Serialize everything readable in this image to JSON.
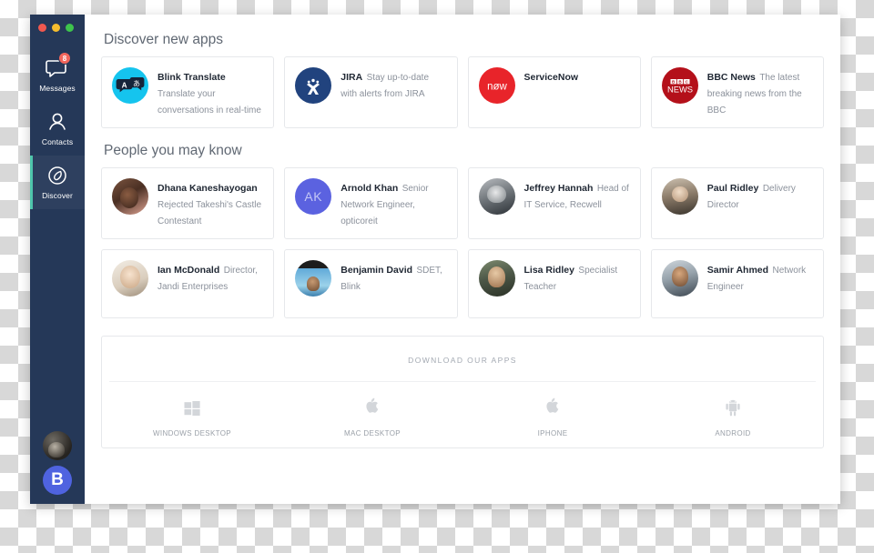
{
  "window": {
    "traffic_lights": [
      "close",
      "minimize",
      "maximize"
    ],
    "colors": {
      "sidebar_bg": "#253858",
      "active_indicator": "#4ec5ab",
      "badge": "#f2665c",
      "team_logo_bg": "#4f63e0"
    }
  },
  "sidebar": {
    "items": [
      {
        "label": "Messages",
        "icon": "message-bubble-icon",
        "badge": "8",
        "active": false
      },
      {
        "label": "Contacts",
        "icon": "person-outline-icon",
        "badge": "",
        "active": false
      },
      {
        "label": "Discover",
        "icon": "compass-icon",
        "badge": "",
        "active": true
      }
    ],
    "user_avatar_name": "user-avatar",
    "team_logo_letter": "B"
  },
  "sections": {
    "apps": {
      "title": "Discover new apps",
      "items": [
        {
          "name": "Blink Translate",
          "description": "Translate your conversations in real-time",
          "logo": "blink-translate-logo"
        },
        {
          "name": "JIRA",
          "description": "Stay up-to-date with alerts from JIRA",
          "logo": "jira-logo"
        },
        {
          "name": "ServiceNow",
          "description": "",
          "logo": "servicenow-logo"
        },
        {
          "name": "BBC News",
          "description": "The latest breaking news from the BBC",
          "logo": "bbc-news-logo"
        }
      ]
    },
    "people": {
      "title": "People you may know",
      "items": [
        {
          "name": "Dhana Kaneshayogan",
          "role": "Rejected Takeshi's Castle Contestant",
          "avatar": "photo",
          "avatar_class": "pa-dhana",
          "initials": ""
        },
        {
          "name": "Arnold Khan",
          "role": "Senior Network Engineer, opticoreit",
          "avatar": "initials",
          "avatar_class": "pa-initials",
          "initials": "AK"
        },
        {
          "name": "Jeffrey Hannah",
          "role": "Head of IT Service, Recwell",
          "avatar": "photo",
          "avatar_class": "pa-jeffrey",
          "initials": ""
        },
        {
          "name": "Paul Ridley",
          "role": "Delivery Director",
          "avatar": "photo",
          "avatar_class": "pa-paul",
          "initials": ""
        },
        {
          "name": "Ian McDonald",
          "role": "Director, Jandi Enterprises",
          "avatar": "photo",
          "avatar_class": "pa-ian",
          "initials": ""
        },
        {
          "name": "Benjamin David",
          "role": "SDET, Blink",
          "avatar": "photo",
          "avatar_class": "pa-benjamin",
          "initials": ""
        },
        {
          "name": "Lisa Ridley",
          "role": "Specialist Teacher",
          "avatar": "photo",
          "avatar_class": "pa-lisa",
          "initials": ""
        },
        {
          "name": "Samir Ahmed",
          "role": "Network Engineer",
          "avatar": "photo",
          "avatar_class": "pa-samir",
          "initials": ""
        }
      ]
    },
    "download": {
      "title": "DOWNLOAD OUR APPS",
      "items": [
        {
          "label": "WINDOWS DESKTOP",
          "icon": "windows-icon"
        },
        {
          "label": "MAC DESKTOP",
          "icon": "apple-icon"
        },
        {
          "label": "IPHONE",
          "icon": "apple-icon"
        },
        {
          "label": "ANDROID",
          "icon": "android-icon"
        }
      ]
    }
  }
}
